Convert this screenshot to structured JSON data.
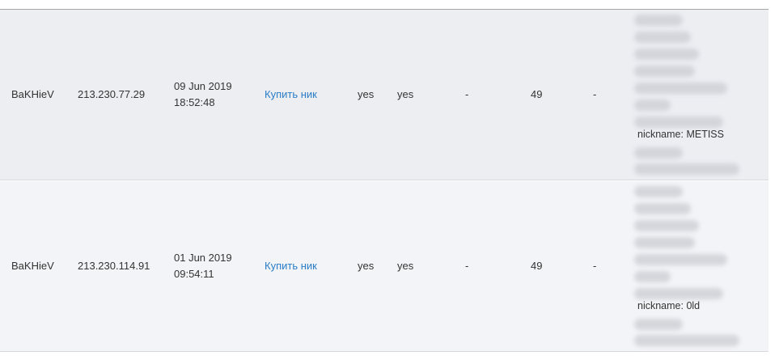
{
  "rows": [
    {
      "name": "BaKHieV",
      "ip": "213.230.77.29",
      "date": "09 Jun 2019",
      "time": "18:52:48",
      "buy_link": "Купить ник",
      "flag1": "yes",
      "flag2": "yes",
      "dash1": "-",
      "number": "49",
      "dash2": "-",
      "nickname_info": "nickname: METISS"
    },
    {
      "name": "BaKHieV",
      "ip": "213.230.114.91",
      "date": "01 Jun 2019",
      "time": "09:54:11",
      "buy_link": "Купить ник",
      "flag1": "yes",
      "flag2": "yes",
      "dash1": "-",
      "number": "49",
      "dash2": "-",
      "nickname_info": "nickname: 0ld"
    }
  ]
}
